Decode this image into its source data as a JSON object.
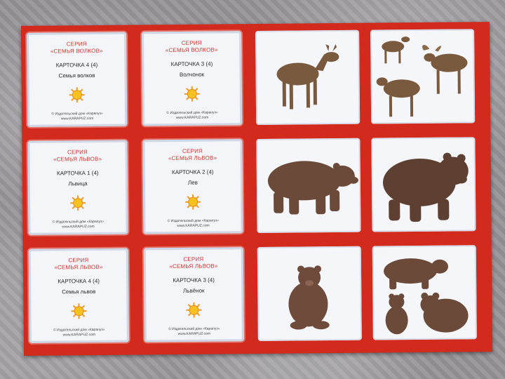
{
  "text_cards": [
    {
      "series": "СЕРИЯ",
      "series_name": "«СЕМЬЯ ВОЛКОВ»",
      "card_no": "КАРТОЧКА 4 (4)",
      "label": "Семья волков",
      "publisher": "© Издательский дом «Карапуз»",
      "website": "www.KARAPUZ.com"
    },
    {
      "series": "СЕРИЯ",
      "series_name": "«СЕМЬЯ ВОЛКОВ»",
      "card_no": "КАРТОЧКА 3 (4)",
      "label": "Волчонок",
      "publisher": "© Издательский дом «Карапуз»",
      "website": "www.KARAPUZ.com"
    },
    {
      "series": "СЕРИЯ",
      "series_name": "«СЕМЬЯ ЛЬВОВ»",
      "card_no": "КАРТОЧКА 1 (4)",
      "label": "Львица",
      "publisher": "© Издательский дом «Карапуз»",
      "website": "www.KARAPUZ.com"
    },
    {
      "series": "СЕРИЯ",
      "series_name": "«СЕМЬЯ ЛЬВОВ»",
      "card_no": "КАРТОЧКА 2 (4)",
      "label": "Лев",
      "publisher": "© Издательский дом «Карапуз»",
      "website": "www.KARAPUZ.com"
    },
    {
      "series": "СЕРИЯ",
      "series_name": "«СЕМЬЯ ЛЬВОВ»",
      "card_no": "КАРТОЧКА 4 (4)",
      "label": "Семья львов",
      "publisher": "© Издательский дом «Карапуз»",
      "website": "www.KARAPUZ.com"
    },
    {
      "series": "СЕРИЯ",
      "series_name": "«СЕМЬЯ ЛЬВОВ»",
      "card_no": "КАРТОЧКА 3 (4)",
      "label": "Львёнок",
      "publisher": "© Издательский дом «Карапуз»",
      "website": "www.KARAPUZ.com"
    }
  ],
  "picture_cards": [
    {
      "subject": "moose-calf"
    },
    {
      "subject": "moose-family"
    },
    {
      "subject": "bear-walking"
    },
    {
      "subject": "bear-large"
    },
    {
      "subject": "bear-cub"
    },
    {
      "subject": "bear-family"
    }
  ],
  "colors": {
    "sheet_red": "#d22a1d",
    "card_bg": "#f3f5f8",
    "series_text": "#d9302a",
    "moose_brown": "#7a5a3e",
    "bear_brown": "#6b4a3a"
  }
}
